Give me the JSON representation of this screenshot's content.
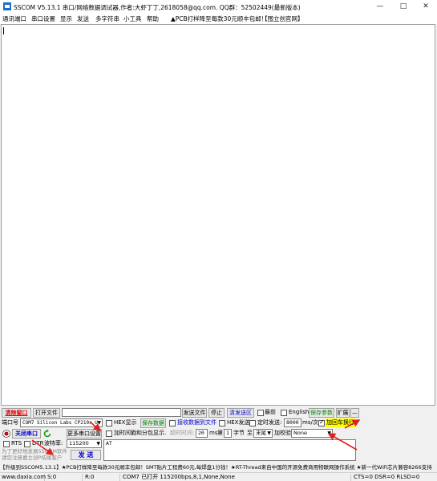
{
  "window": {
    "title": "SSCOM V5.13.1 串口/网络数据调试器,作者:大虾丁丁,2618058@qq.com. QQ群：52502449(最新版本)",
    "minimize": "—",
    "maximize": "□",
    "close": "✕"
  },
  "menu": {
    "items": [
      "通讯端口",
      "串口设置",
      "显示",
      "发送",
      "多字符串",
      "小工具",
      "帮助"
    ],
    "ad": "▲PCB打样降至每款30元顺丰包邮！",
    "official": "【囤立创官网】"
  },
  "toolbar": {
    "clear_window": "清除窗口",
    "open_file": "打开文件",
    "send_file": "发送文件",
    "stop": "停止",
    "clear_send": "清发送区",
    "topmost": "最前",
    "english": "English",
    "save_params": "保存参数",
    "expand": "扩展",
    "collapse": "—"
  },
  "row2": {
    "port_label": "端口号",
    "port_value": "COM7 Silicon Labs CP210x U",
    "hex_display": "HEX显示",
    "save_data": "保存数据",
    "recv_to_file": "接收数据到文件",
    "hex_send": "HEX发送",
    "timed_send": "定时发送:",
    "interval": "8000",
    "interval_unit": "ms/次",
    "add_crlf": "加回车换行"
  },
  "row3": {
    "close_port": "关闭串口",
    "more_settings": "更多串口设置",
    "timestamp": "加时间戳和分包显示.",
    "timeout_label": "超时时间:",
    "timeout_value": "20",
    "timeout_unit": "ms",
    "byte_label": "第",
    "byte_value": "1",
    "byte_unit": "字节",
    "to_label": "至",
    "to_value": "末尾",
    "checksum_label": "加校验",
    "checksum_value": "None"
  },
  "row4": {
    "rts": "RTS",
    "dtr": "DTR",
    "baud_label": "波特率:",
    "baud_value": "115200",
    "send_text": "AT",
    "send_button": "发 送"
  },
  "notice": {
    "line1": "为了更好地发展SSCOM软件",
    "line2": "请您注册嘉立创P结尾客户"
  },
  "marquee": "【升级到SSCOM5.13.1】★PCB打样降至每款30元顺丰包邮！SMT贴片工程费60元,每焊盘1分钱！★RT-Thread来自中国的开源免费商用物联网操作系统 ★新一代WiFi芯片兼容8266支持",
  "status": {
    "website": "www.daxia.com",
    "sent": "S:0",
    "received": "R:0",
    "port_status": "COM7 已打开  115200bps,8,1,None,None",
    "signals": "CTS=0 DSR=0 RLSD=0"
  },
  "colors": {
    "accent_red": "#dd0000",
    "arrow_red": "#e02020",
    "highlight_yellow": "#ffff00",
    "link_green": "#008800",
    "link_blue": "#0000cc"
  }
}
